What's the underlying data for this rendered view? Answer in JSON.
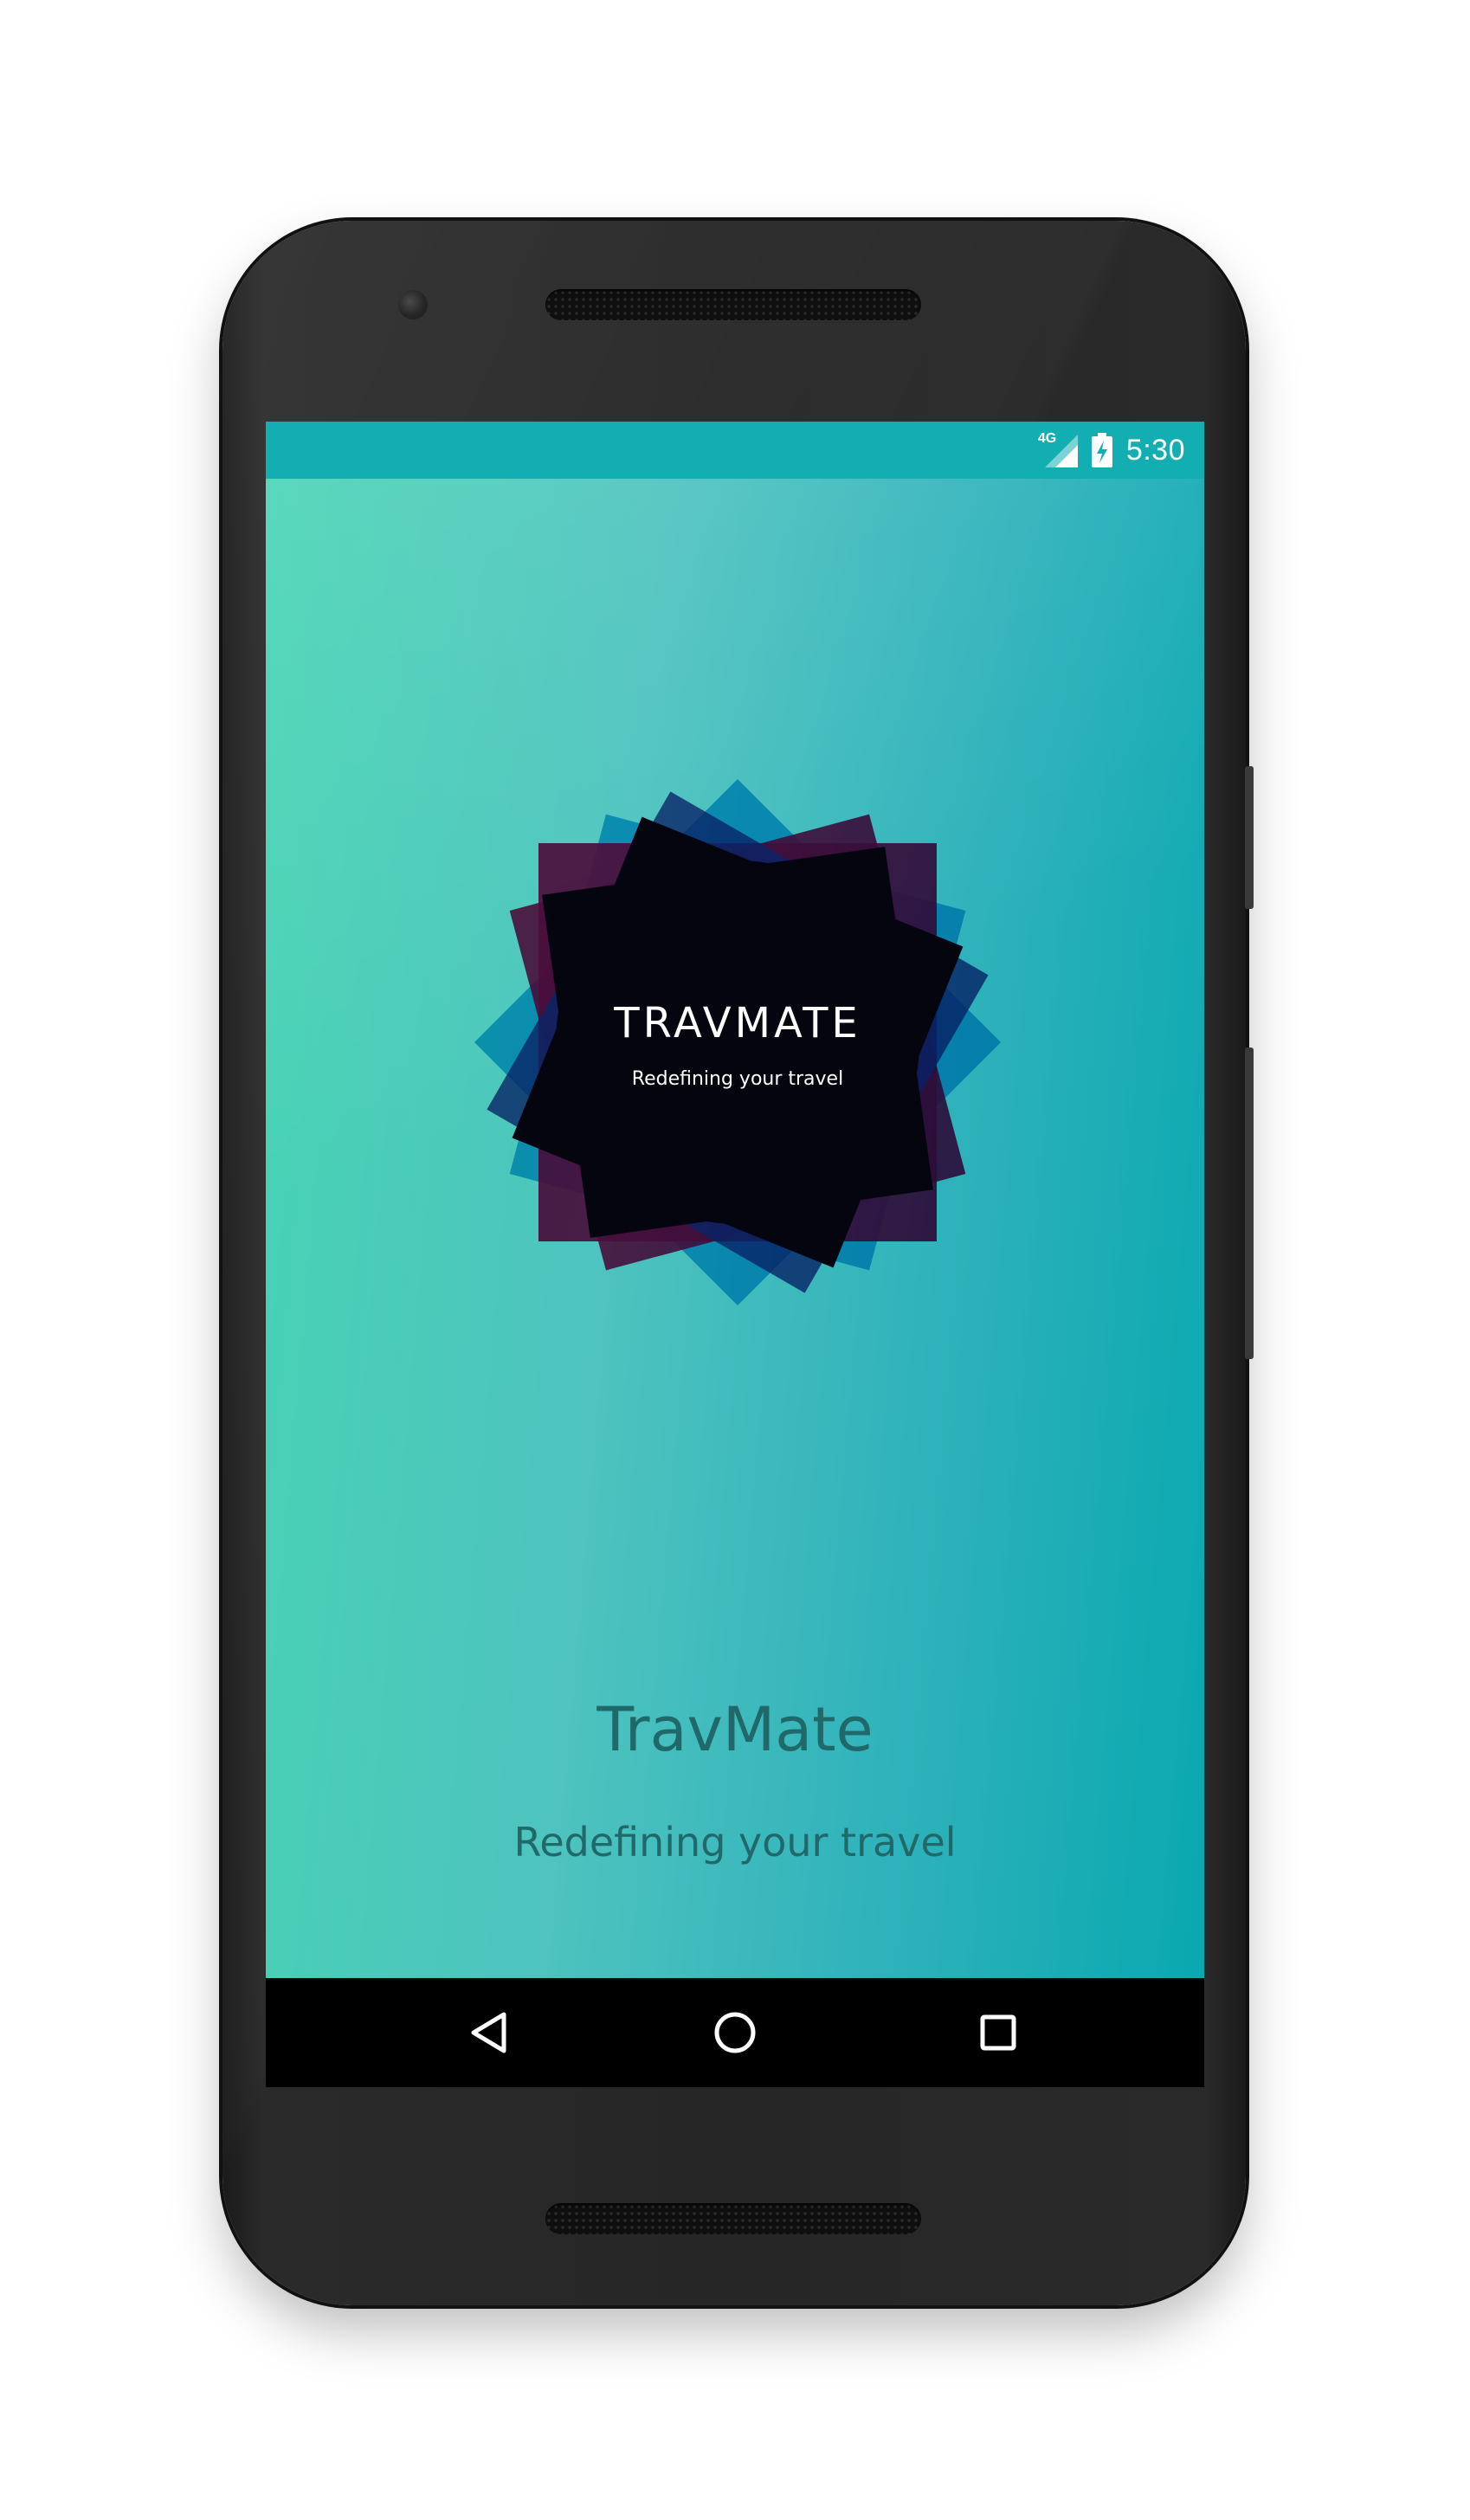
{
  "status_bar": {
    "network_label": "4G",
    "time": "5:30",
    "icons": [
      "signal-4g-icon",
      "battery-charging-icon"
    ],
    "color": "#13aeb2"
  },
  "splash": {
    "logo_title": "TRAVMATE",
    "logo_subtitle": "Redefining your travel",
    "app_name": "TravMate",
    "tagline": "Redefining your travel",
    "logo_colors": {
      "blue": "#0aaee8",
      "red": "#e8124f",
      "center": "#050510"
    },
    "gradient": [
      "#47d4b4",
      "#09a8b0"
    ]
  },
  "nav_bar": {
    "icons": [
      "back-triangle-icon",
      "home-circle-icon",
      "recents-square-icon"
    ]
  }
}
